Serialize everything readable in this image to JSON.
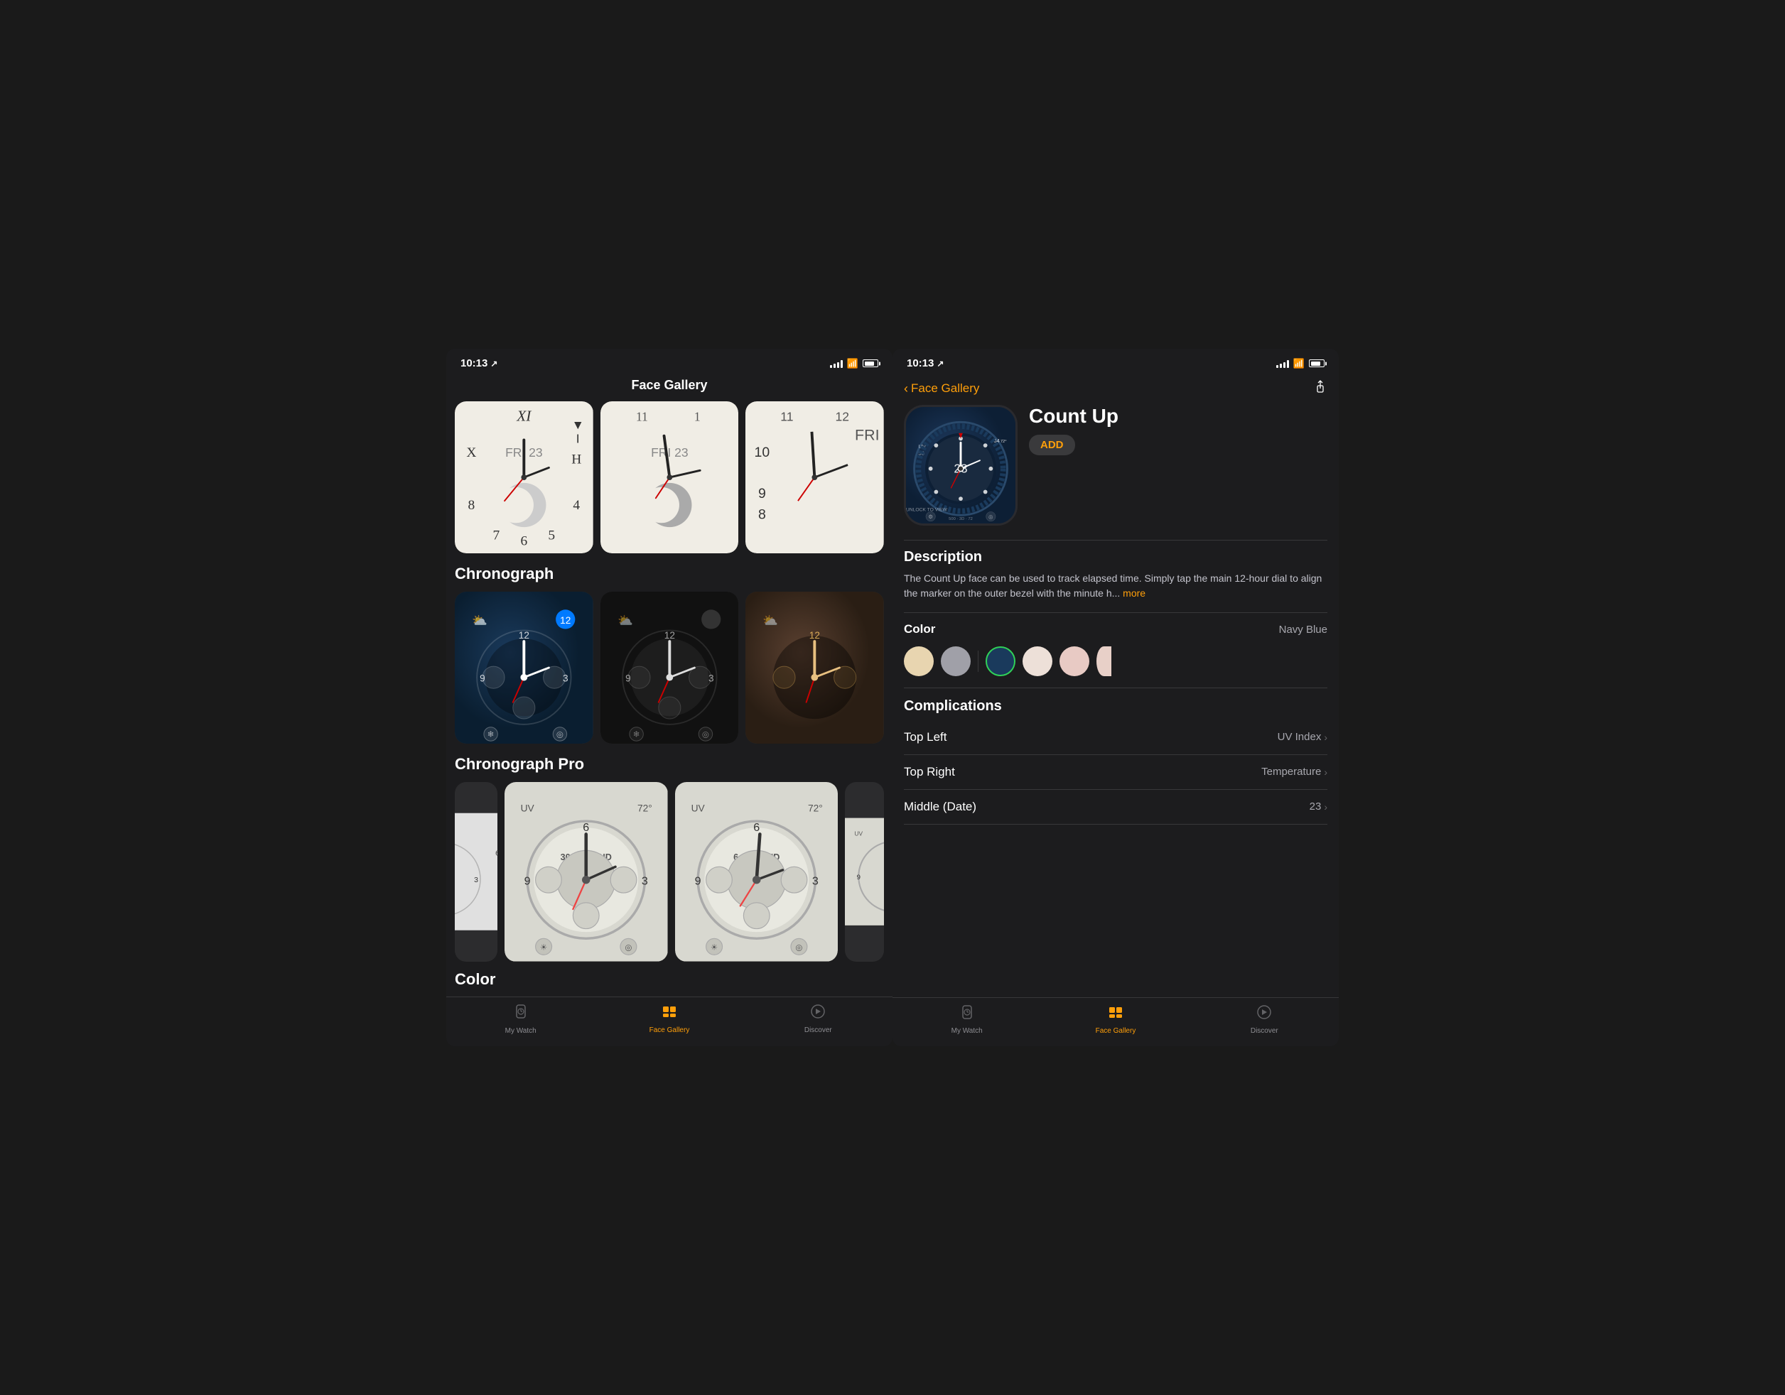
{
  "left_screen": {
    "status": {
      "time": "10:13",
      "location": true,
      "signal": 3,
      "wifi": true,
      "battery": 80
    },
    "title": "Face Gallery",
    "sections": [
      {
        "id": "top-row",
        "label": null,
        "faces": [
          "numerals-light",
          "numerals-light-2",
          "numerals-partial"
        ]
      },
      {
        "id": "chronograph",
        "label": "Chronograph",
        "faces": [
          "chron-blue",
          "chron-dark",
          "chron-brown-partial"
        ]
      },
      {
        "id": "chronograph-pro",
        "label": "Chronograph Pro",
        "faces": [
          "chron-pro-partial",
          "chron-pro-white-1",
          "chron-pro-white-2",
          "chron-pro-white-3"
        ]
      },
      {
        "id": "color",
        "label": "Color",
        "faces": []
      }
    ],
    "tab_bar": {
      "items": [
        {
          "id": "my-watch",
          "label": "My Watch",
          "icon": "⌚",
          "active": false
        },
        {
          "id": "face-gallery",
          "label": "Face Gallery",
          "icon": "🟧",
          "active": true
        },
        {
          "id": "discover",
          "label": "Discover",
          "icon": "🧭",
          "active": false
        }
      ]
    }
  },
  "right_screen": {
    "status": {
      "time": "10:13",
      "location": true,
      "signal": 3,
      "wifi": true,
      "battery": 80
    },
    "header": {
      "back_label": "Face Gallery",
      "share_icon": "share"
    },
    "face": {
      "name": "Count Up",
      "add_label": "ADD",
      "color_selected": "Navy Blue",
      "description_title": "Description",
      "description": "The Count Up face can be used to track elapsed time. Simply tap the main 12-hour dial to align the marker on the outer bezel with the minute h...",
      "more_label": "more"
    },
    "color_section": {
      "label": "Color",
      "selected_value": "Navy Blue",
      "swatches": [
        {
          "id": "cream",
          "color": "#e8d5b0",
          "selected": false
        },
        {
          "id": "gray",
          "color": "#a0a0a8",
          "selected": false
        },
        {
          "id": "navy",
          "color": "#1a3a5c",
          "selected": true
        },
        {
          "id": "light-pink",
          "color": "#ede0d8",
          "selected": false
        },
        {
          "id": "rose",
          "color": "#e8cac4",
          "selected": false
        },
        {
          "id": "partial",
          "color": "#e8d0c8",
          "selected": false
        }
      ]
    },
    "complications": {
      "title": "Complications",
      "items": [
        {
          "label": "Top Left",
          "value": "UV Index",
          "id": "top-left"
        },
        {
          "label": "Top Right",
          "value": "Temperature",
          "id": "top-right"
        },
        {
          "label": "Middle (Date)",
          "value": "23",
          "id": "middle-date"
        }
      ]
    },
    "tab_bar": {
      "items": [
        {
          "id": "my-watch",
          "label": "My Watch",
          "icon": "⌚",
          "active": false
        },
        {
          "id": "face-gallery",
          "label": "Face Gallery",
          "icon": "🟧",
          "active": true
        },
        {
          "id": "discover",
          "label": "Discover",
          "icon": "🧭",
          "active": false
        }
      ]
    }
  }
}
